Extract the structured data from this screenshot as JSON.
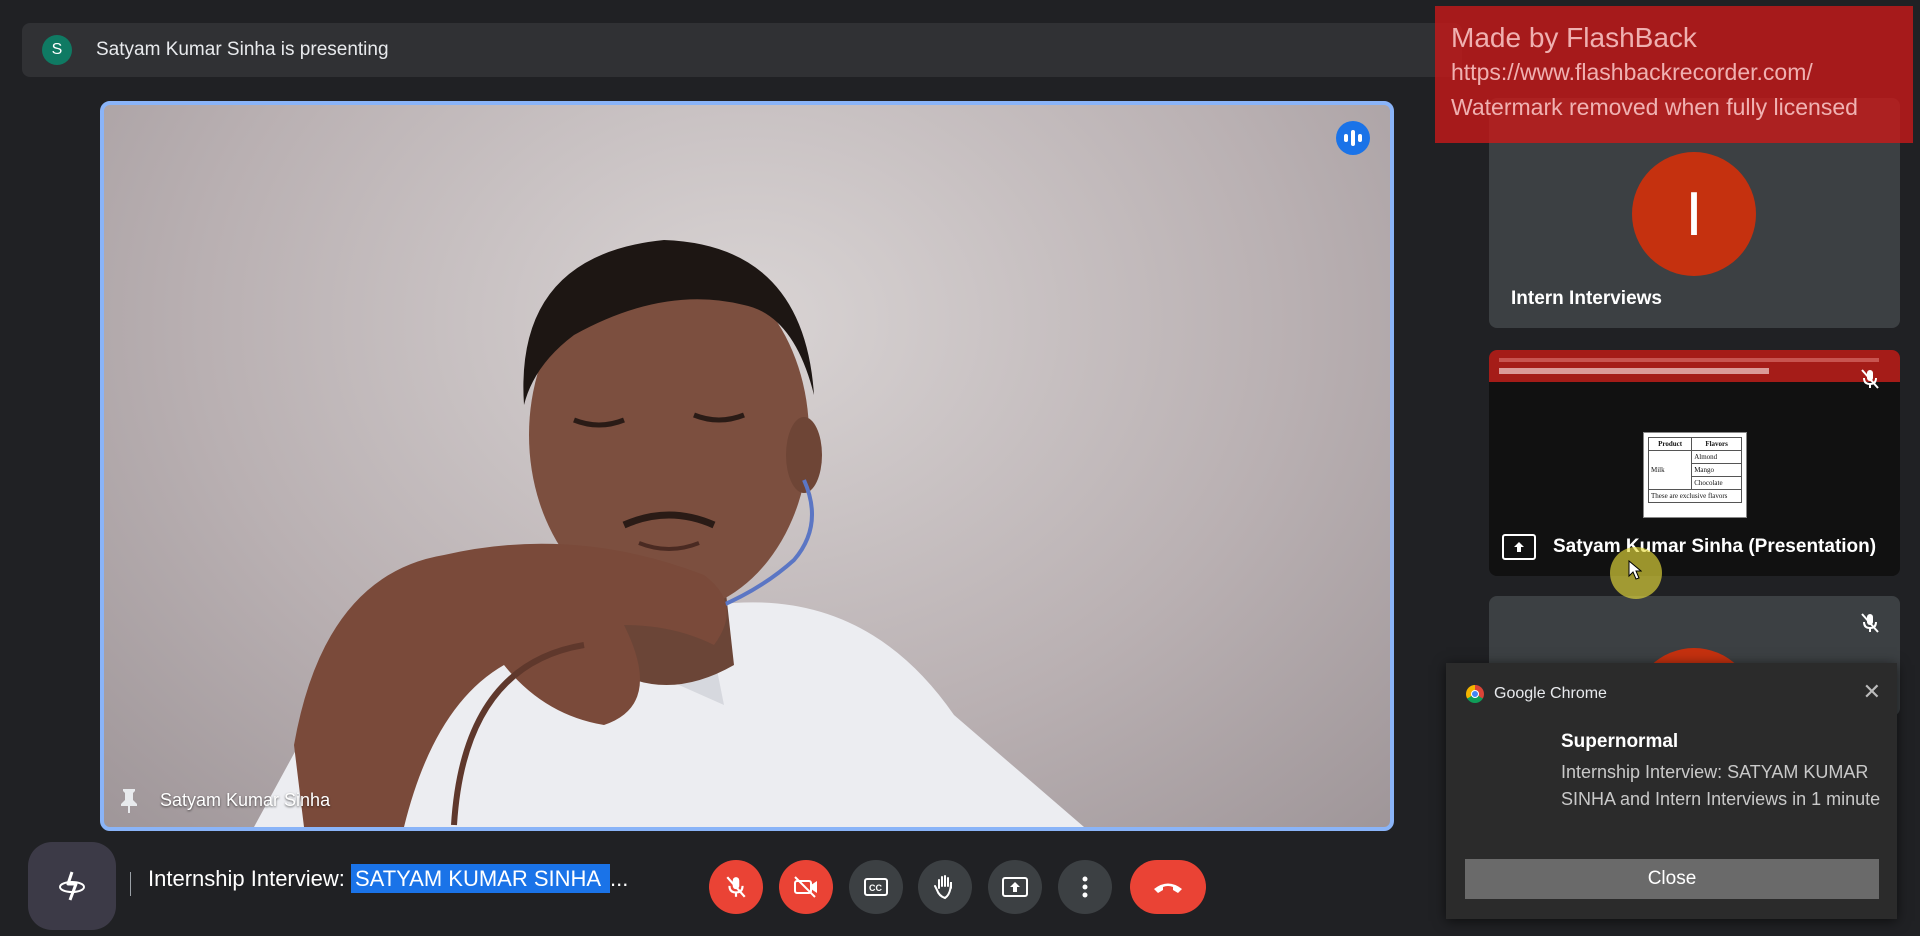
{
  "presenting_bar": {
    "avatar_letter": "S",
    "text": "Satyam Kumar Sinha is presenting"
  },
  "main_tile": {
    "participant_name": "Satyam Kumar Sinha",
    "pin_icon": "pin-icon",
    "speaking_icon": "audio-level-icon"
  },
  "side_tiles": [
    {
      "avatar_letter": "I",
      "name": "Intern Interviews",
      "avatar_color": "#c5310f"
    },
    {
      "name": "Satyam Kumar Sinha (Presentation)",
      "icon": "present-to-all-icon",
      "mini_table": {
        "headers": [
          "Product",
          "Flavors"
        ],
        "row_label": "Milk",
        "flavors": [
          "Almond",
          "Mango",
          "Chocolate"
        ],
        "footer": "These are exclusive flavors"
      }
    },
    {
      "icon": "mic-off-icon"
    }
  ],
  "watermark": {
    "line1": "Made by FlashBack",
    "line2": "https://www.flashbackrecorder.com/",
    "line3": "Watermark removed when fully licensed"
  },
  "notification": {
    "app": "Google Chrome",
    "title": "Supernormal",
    "body": "Internship Interview: SATYAM KUMAR SINHA and Intern Interviews in 1 minute",
    "close_label": "Close",
    "close_icon": "close-icon"
  },
  "bottom_bar": {
    "title_prefix": "Internship Interview: ",
    "title_selected": "SATYAM KUMAR SINHA ",
    "title_suffix": "...",
    "controls": [
      "mic-off-icon",
      "camera-off-icon",
      "closed-captions-icon",
      "raise-hand-icon",
      "present-screen-icon",
      "more-options-icon",
      "end-call-icon"
    ]
  },
  "colors": {
    "accent": "#1a73e8",
    "danger": "#ea4335",
    "background": "#202124",
    "tile": "#3c4043"
  }
}
